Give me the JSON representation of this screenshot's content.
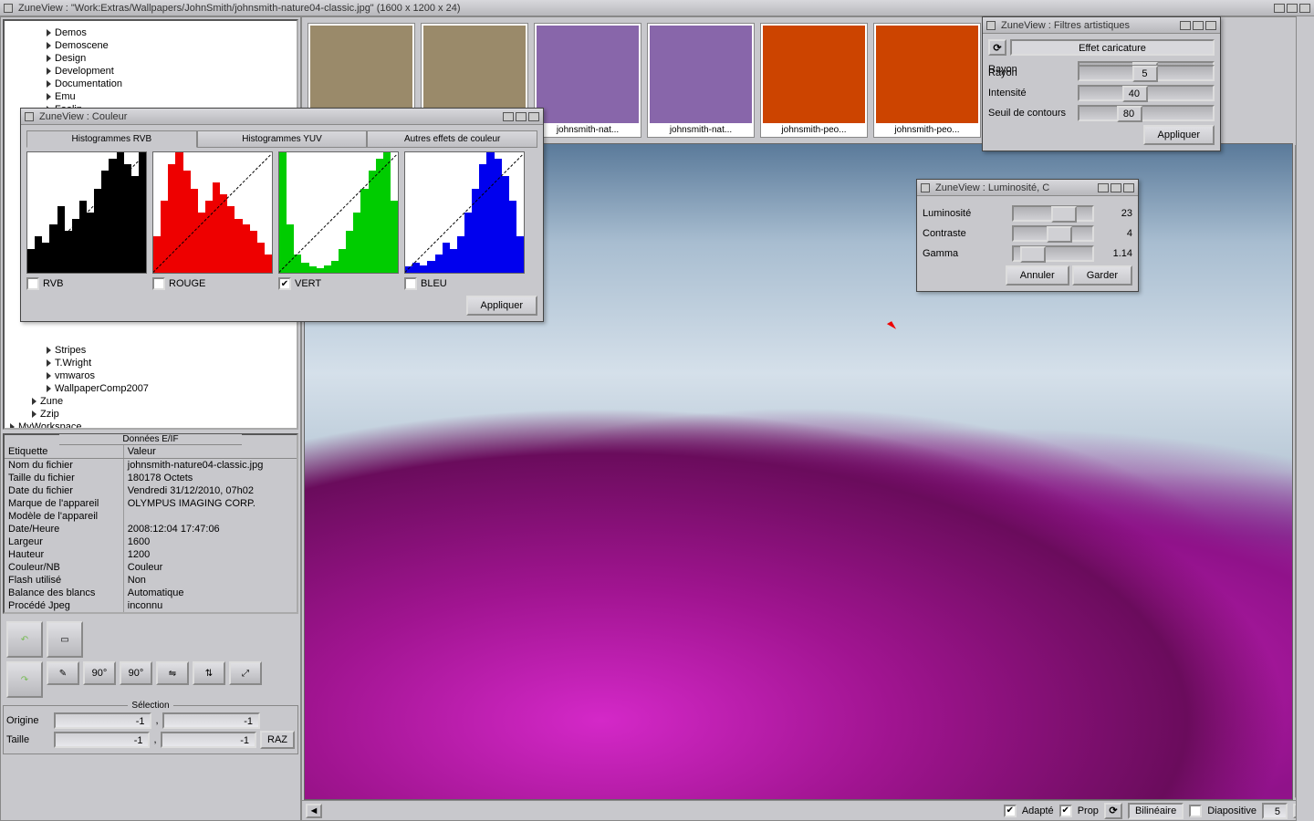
{
  "main_title": "ZuneView : \"Work:Extras/Wallpapers/JohnSmith/johnsmith-nature04-classic.jpg\" (1600 x 1200 x 24)",
  "tree": {
    "items_top": [
      "Demos",
      "Demoscene",
      "Design",
      "Development",
      "Documentation",
      "Emu",
      "Feelin"
    ],
    "items_bottom": [
      "Stripes",
      "T.Wright",
      "vmwaros",
      "WallpaperComp2007"
    ],
    "items_lvl1": [
      "Zune",
      "Zzip"
    ],
    "items_root": [
      "MyWorkspace"
    ]
  },
  "exif": {
    "header": "Données E/IF",
    "col1": "Etiquette",
    "col2": "Valeur",
    "rows": [
      [
        "Nom du fichier",
        "johnsmith-nature04-classic.jpg"
      ],
      [
        "Taille du fichier",
        "180178 Octets"
      ],
      [
        "Date du fichier",
        "Vendredi 31/12/2010, 07h02"
      ],
      [
        "Marque de l'appareil",
        "OLYMPUS IMAGING CORP."
      ],
      [
        "Modèle de l'appareil",
        ""
      ],
      [
        "Date/Heure",
        "2008:12:04 17:47:06"
      ],
      [
        "Largeur",
        "1600"
      ],
      [
        "Hauteur",
        "1200"
      ],
      [
        "Couleur/NB",
        "Couleur"
      ],
      [
        "Flash utilisé",
        "Non"
      ],
      [
        "Balance des blancs",
        "Automatique"
      ],
      [
        "Procédé Jpeg",
        "inconnu"
      ]
    ]
  },
  "tools": {
    "rot_left": "90°",
    "rot_right": "90°"
  },
  "selection": {
    "header": "Sélection",
    "origin": "Origine",
    "origin_x": "-1",
    "origin_y": "-1",
    "size": "Taille",
    "size_w": "-1",
    "size_h": "-1",
    "raz": "RAZ"
  },
  "thumbs": [
    "",
    "",
    "johnsmith-nat...",
    "johnsmith-nat...",
    "johnsmith-peo...",
    "johnsmith-peo..."
  ],
  "status": {
    "fit": "Adapté",
    "prop": "Prop",
    "filter": "Bilinéaire",
    "slide": "Diapositive",
    "slide_val": "5"
  },
  "color_win": {
    "title": "ZuneView : Couleur",
    "tab1": "Histogrammes RVB",
    "tab2": "Histogrammes YUV",
    "tab3": "Autres effets de couleur",
    "rvb": "RVB",
    "rouge": "ROUGE",
    "vert": "VERT",
    "bleu": "BLEU",
    "apply": "Appliquer"
  },
  "lum_win": {
    "title": "ZuneView : Luminosité, C",
    "lum": "Luminosité",
    "lum_v": "23",
    "con": "Contraste",
    "con_v": "4",
    "gam": "Gamma",
    "gam_v": "1.14",
    "cancel": "Annuler",
    "keep": "Garder"
  },
  "art_win": {
    "title": "ZuneView : Filtres artistiques",
    "effect": "Effet caricature",
    "radius": "Rayon",
    "radius_v": "5",
    "intens": "Intensité",
    "intens_v": "40",
    "edge": "Seuil de contours",
    "edge_v": "80",
    "apply": "Appliquer"
  }
}
